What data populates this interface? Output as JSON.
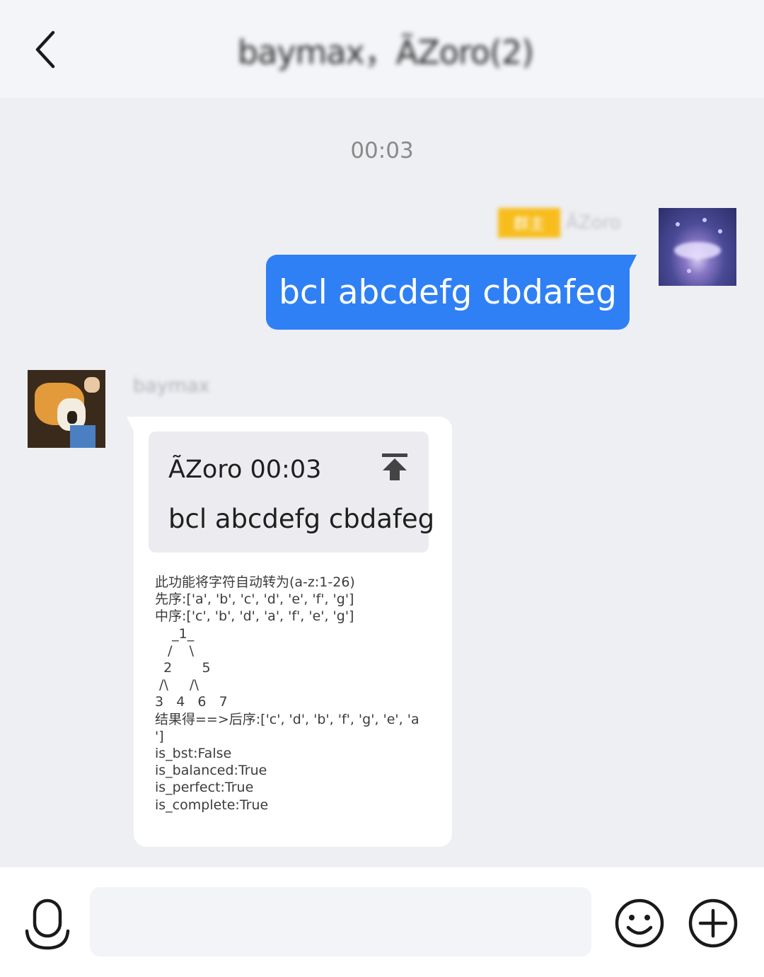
{
  "header": {
    "title": "baymax，ÃZoro(2)"
  },
  "chat": {
    "timestamp": "00:03",
    "self_message": {
      "badge": "群主",
      "sender": "ÃZoro",
      "text": "bcl abcdefg cbdafeg"
    },
    "other_message": {
      "sender": "baymax",
      "quote": {
        "author_time": "ÃZoro 00:03",
        "text": "bcl abcdefg cbdafeg"
      },
      "reply_text": "此功能将字符自动转为(a-z:1-26)\n先序:['a', 'b', 'c', 'd', 'e', 'f', 'g']\n中序:['c', 'b', 'd', 'a', 'f', 'e', 'g']\n    _1_\n   /    \\\n  2       5\n /\\     /\\\n3   4   6   7\n结果得==>后序:['c', 'd', 'b', 'f', 'g', 'e', 'a\n']\nis_bst:False\nis_balanced:True\nis_perfect:True\nis_complete:True"
    }
  },
  "input": {
    "placeholder": "",
    "value": ""
  },
  "icons": {
    "back": "chevron-left-icon",
    "mic": "microphone-icon",
    "emoji": "smiley-icon",
    "plus": "plus-circle-icon",
    "jump": "jump-to-top-icon"
  },
  "colors": {
    "accent": "#2f80f5",
    "badge": "#f7bd1d",
    "background": "#eeeff3"
  }
}
